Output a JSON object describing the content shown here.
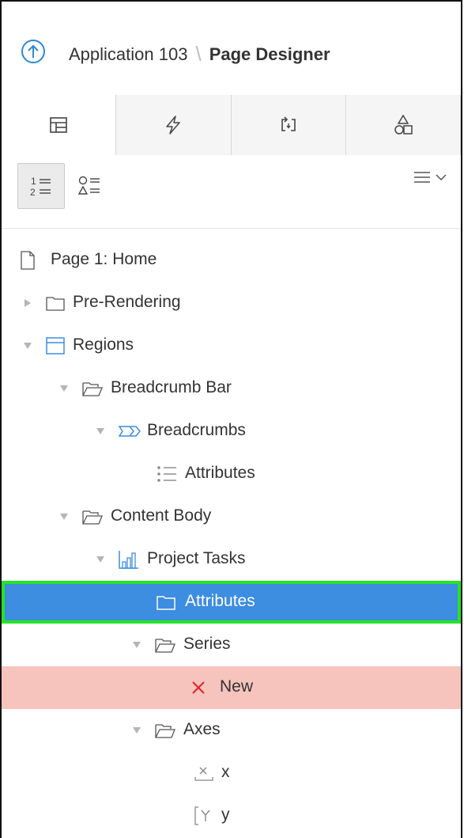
{
  "header": {
    "app_label": "Application 103",
    "separator": "\\",
    "current": "Page Designer"
  },
  "tabs": [
    {
      "icon": "rendering-tree-icon",
      "active": true
    },
    {
      "icon": "dynamic-actions-lightning-icon",
      "active": false
    },
    {
      "icon": "processing-arrows-icon",
      "active": false
    },
    {
      "icon": "shared-components-shapes-icon",
      "active": false
    }
  ],
  "toolbar": {
    "view_by_type_icon": "numbered-list-icon",
    "view_by_component_icon": "shapes-list-icon",
    "menu_icon": "hamburger-chevron-icon"
  },
  "tree": {
    "page": "Page 1: Home",
    "pre_rendering": "Pre-Rendering",
    "regions": "Regions",
    "breadcrumb_bar": "Breadcrumb Bar",
    "breadcrumbs": "Breadcrumbs",
    "breadcrumbs_attributes": "Attributes",
    "content_body": "Content Body",
    "project_tasks": "Project Tasks",
    "chart_attributes": "Attributes",
    "series": "Series",
    "new_series": "New",
    "axes": "Axes",
    "axis_x": "x",
    "axis_y": "y"
  },
  "colors": {
    "selected_bg": "#3d8de0",
    "selected_outline": "#25e425",
    "error_bg": "#f6c3bd",
    "error_icon": "#e02020",
    "accent_blue": "#2b8ad6"
  }
}
